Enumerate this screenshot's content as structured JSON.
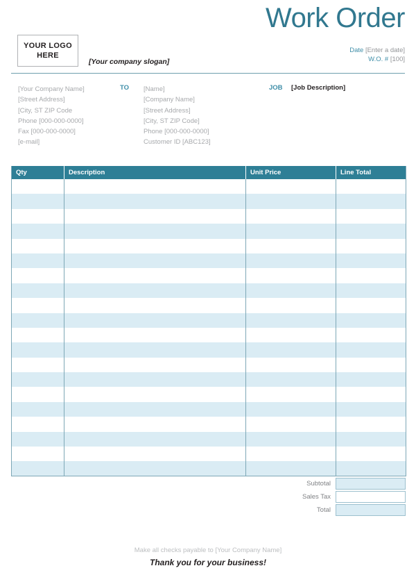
{
  "header": {
    "title": "Work Order",
    "logo_line1": "YOUR LOGO",
    "logo_line2": "HERE",
    "slogan": "[Your company slogan]",
    "date_label": "Date",
    "date_value": "[Enter a date]",
    "wo_label": "W.O. #",
    "wo_value": "[100]"
  },
  "from": {
    "lines": [
      "[Your Company Name]",
      "[Street Address]",
      "[City, ST  ZIP Code",
      "Phone [000-000-0000]",
      "Fax [000-000-0000]",
      "[e-mail]"
    ]
  },
  "to": {
    "tag": "TO",
    "lines": [
      "[Name]",
      "[Company Name]",
      "[Street Address]",
      "[City, ST  ZIP Code]",
      "Phone [000-000-0000]",
      "Customer ID [ABC123]"
    ]
  },
  "job": {
    "tag": "JOB",
    "description": "[Job Description]"
  },
  "items_table": {
    "columns": [
      "Qty",
      "Description",
      "Unit Price",
      "Line Total"
    ],
    "row_count": 20,
    "rows": []
  },
  "totals": [
    {
      "label": "Subtotal",
      "value": "",
      "filled": true
    },
    {
      "label": "Sales Tax",
      "value": "",
      "filled": false
    },
    {
      "label": "Total",
      "value": "",
      "filled": true
    }
  ],
  "footer": {
    "payable": "Make all checks payable to [Your Company Name]",
    "thanks": "Thank you for your business!"
  },
  "colors": {
    "title_teal": "#31788f",
    "header_teal": "#2e7f96",
    "row_blue": "#daecf4",
    "rule_teal": "#6e9fae",
    "label_gray": "#a7a9ac"
  }
}
